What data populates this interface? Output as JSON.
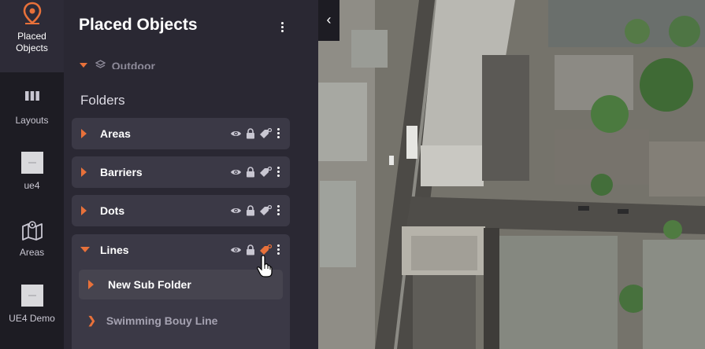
{
  "rail": {
    "items": [
      {
        "label": "Placed\nObjects",
        "icon": "map-pin-icon",
        "active": true
      },
      {
        "label": "Layouts",
        "icon": "columns-icon"
      },
      {
        "label": "ue4",
        "icon": "thumbnail"
      },
      {
        "label": "Areas",
        "icon": "folded-map-icon"
      },
      {
        "label": "UE4 Demo",
        "icon": "thumbnail"
      }
    ]
  },
  "panel": {
    "title": "Placed Objects",
    "partial_item": "Outdoor",
    "folders_label": "Folders",
    "folders": [
      {
        "name": "Areas"
      },
      {
        "name": "Barriers"
      },
      {
        "name": "Dots"
      },
      {
        "name": "Lines",
        "expanded": true
      }
    ],
    "lines_children": {
      "sub_folder": "New Sub Folder",
      "item": "Swimming Bouy Line"
    }
  },
  "colors": {
    "accent": "#e8713a",
    "rail_bg": "#1d1c23",
    "panel_bg": "#2a2833",
    "folder_bg": "#3b3946"
  }
}
